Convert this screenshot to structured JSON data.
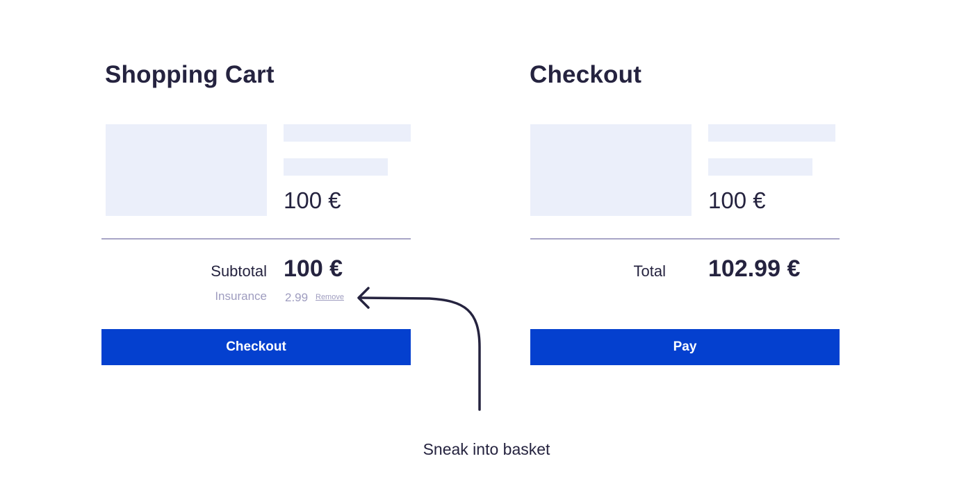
{
  "cart": {
    "title": "Shopping Cart",
    "item_price": "100 €",
    "subtotal_label": "Subtotal",
    "subtotal_value": "100 €",
    "insurance_label": "Insurance",
    "insurance_value": "2.99",
    "remove_label": "Remove",
    "button_label": "Checkout"
  },
  "checkout": {
    "title": "Checkout",
    "item_price": "100 €",
    "total_label": "Total",
    "total_value": "102.99 €",
    "button_label": "Pay"
  },
  "annotation": {
    "caption": "Sneak into basket"
  },
  "colors": {
    "primary": "#0440cf",
    "text": "#25233f",
    "muted": "#9e9cbf",
    "placeholder": "#ebeffa",
    "divider": "#a8a5c6"
  },
  "icons": [
    "curved-arrow-icon"
  ]
}
